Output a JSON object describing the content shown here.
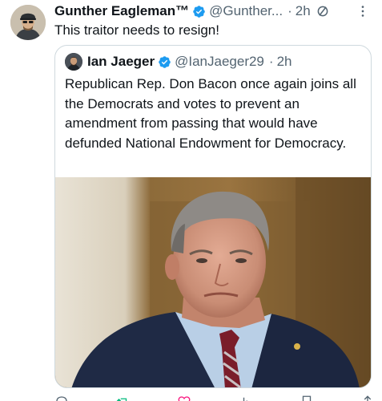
{
  "tweet": {
    "author_name": "Gunther Eagleman™",
    "author_handle": "@Gunther...",
    "time_separator": "·",
    "time": "2h",
    "text": "This traitor needs to resign!",
    "icons": [
      "verified-badge-icon",
      "slash-circle-icon",
      "more-options-icon"
    ]
  },
  "quote": {
    "author_name": "Ian Jaeger",
    "author_handle": "@IanJaeger29",
    "time_separator": "·",
    "time": "2h",
    "text": "Republican Rep. Don Bacon once again joins all the Democrats and votes to prevent an amendment from passing that would have defunded National Endowment for Democracy."
  },
  "actions": [
    "reply-icon",
    "repost-icon",
    "like-icon",
    "views-icon",
    "bookmark-icon",
    "share-icon"
  ],
  "colors": {
    "text": "#0f1419",
    "secondary": "#536471",
    "verified": "#1d9bf0",
    "border": "#cfd9de"
  }
}
